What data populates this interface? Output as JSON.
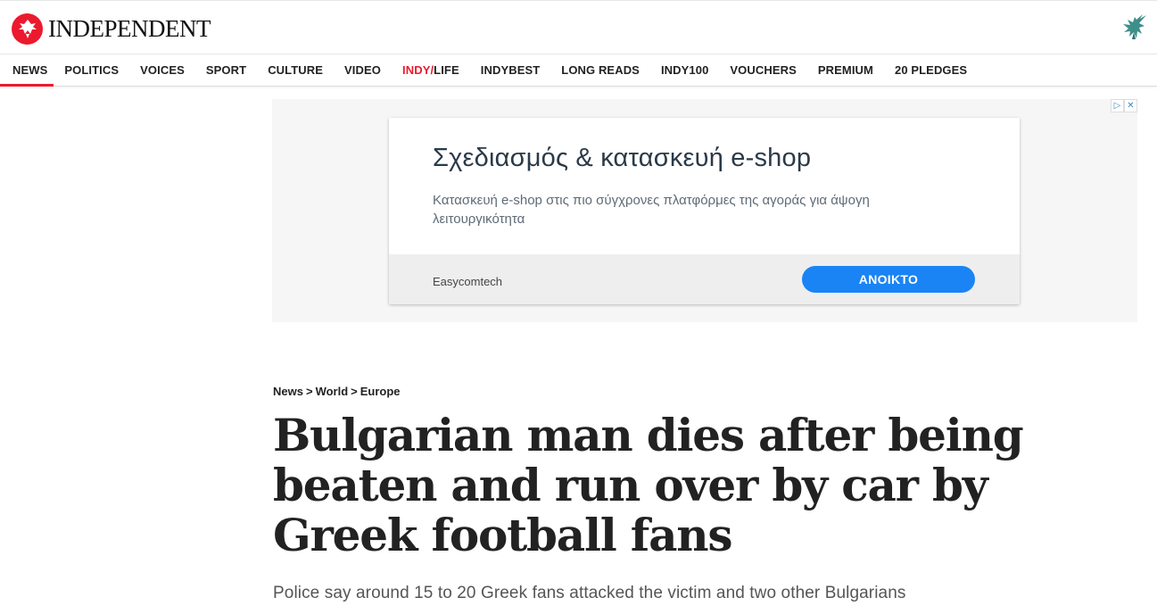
{
  "header": {
    "logo_text": "INDEPENDENT",
    "logo_icon": "eagle-icon",
    "right_icon": "eagle-icon",
    "brand_color": "#ec1a2e"
  },
  "nav": {
    "items": [
      {
        "label": "NEWS",
        "active": true
      },
      {
        "label": "POLITICS"
      },
      {
        "label": "VOICES"
      },
      {
        "label": "SPORT"
      },
      {
        "label": "CULTURE"
      },
      {
        "label": "VIDEO"
      },
      {
        "label_red": "INDY/",
        "label_rest": "LIFE"
      },
      {
        "label": "INDYBEST"
      },
      {
        "label": "LONG READS"
      },
      {
        "label": "INDY100"
      },
      {
        "label": "VOUCHERS"
      },
      {
        "label": "PREMIUM"
      },
      {
        "label": "20 PLEDGES"
      }
    ]
  },
  "ad": {
    "choices_icons": [
      "adchoices-icon",
      "close-icon"
    ],
    "title": "Σχεδιασμός & κατασκευή e-shop",
    "description": "Κατασκευή e-shop στις πιο σύγχρονες πλατφόρμες της αγοράς για άψογη λειτουργικότητα",
    "advertiser": "Easycomtech",
    "cta": "ΑΝΟΙΚΤΟ",
    "cta_color": "#1a84f5"
  },
  "article": {
    "breadcrumb": [
      "News",
      "World",
      "Europe"
    ],
    "breadcrumb_separator": ">",
    "headline": "Bulgarian man dies after being beaten and run over by car by Greek football fans",
    "standfirst": "Police say around 15 to 20 Greek fans attacked the victim and two other Bulgarians"
  }
}
